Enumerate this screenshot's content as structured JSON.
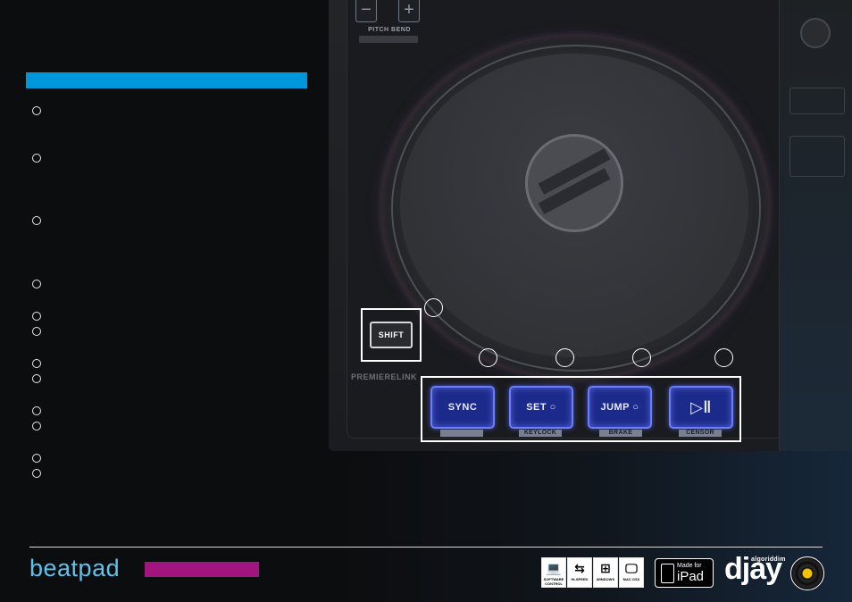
{
  "device": {
    "pitch_minus": "−",
    "pitch_plus": "+",
    "pitch_label": "PITCH BEND",
    "shift_label": "SHIFT",
    "brand": "PREMIERELINK"
  },
  "pads": [
    {
      "label": "SYNC",
      "sub": "",
      "icon": ""
    },
    {
      "label": "SET",
      "sub": "KEYLOCK",
      "icon": "circle-icon"
    },
    {
      "label": "JUMP",
      "sub": "BRAKE",
      "icon": "circle-icon"
    },
    {
      "label": "",
      "sub": "CENSOR",
      "icon": "play-pause-icon"
    }
  ],
  "footer": {
    "brand": "beatpad",
    "compat": [
      {
        "name": "software-control-icon",
        "label": "SOFTWARE CONTROL"
      },
      {
        "name": "usb-hispeed-icon",
        "label": "HI-SPEED"
      },
      {
        "name": "windows-icon",
        "label": "WINDOWS"
      },
      {
        "name": "mac-osx-icon",
        "label": "MAC OSX"
      }
    ],
    "ipad_top": "Made for",
    "ipad_main": "iPad",
    "djay_small": "algoriddim",
    "djay_main": "djay"
  },
  "colors": {
    "accent_blue": "#0096dc",
    "accent_magenta": "#a3157e",
    "pad_glow": "#6a7cff"
  }
}
